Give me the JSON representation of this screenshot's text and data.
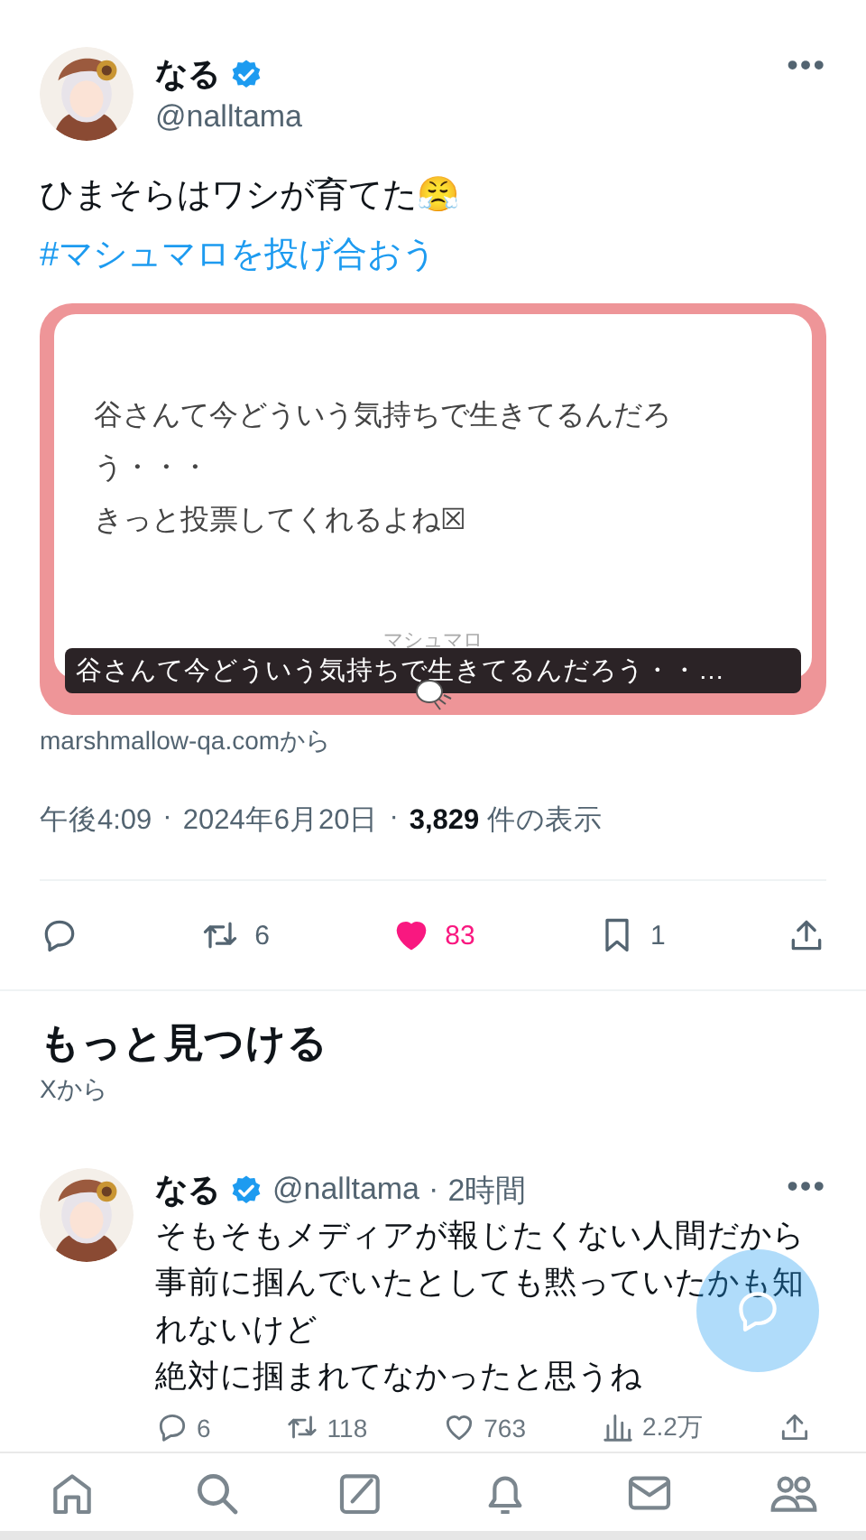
{
  "tweet": {
    "author": {
      "name": "なる",
      "verified": true,
      "handle": "@nalltama"
    },
    "more_label": "•••",
    "text": "ひまそらはワシが育てた😤",
    "hashtag": "#マシュマロを投げ合おう",
    "card": {
      "lines": [
        "谷さんて今どういう気持ちで生きてるんだろ",
        "う・・・",
        "きっと投票してくれるよね☒"
      ],
      "brand": "マシュマロ",
      "caption": "谷さんて今どういう気持ちで生きてるんだろう・・…",
      "source": "marshmallow-qa.comから"
    },
    "meta": {
      "separator": "·",
      "time": "午後4:09",
      "date": "2024年6月20日",
      "views": "3,829",
      "views_label": "件の表示"
    },
    "actions": [
      {
        "kind": "reply"
      },
      {
        "kind": "retweet",
        "count": "6"
      },
      {
        "kind": "like",
        "count": "83",
        "active": true
      },
      {
        "kind": "bookmark",
        "count": "1",
        "active": false
      },
      {
        "kind": "share"
      }
    ]
  },
  "more": {
    "title": "もっと見つける",
    "subtitle": "Xから"
  },
  "related": {
    "author": {
      "name": "なる",
      "verified": true,
      "handle": "@nalltama"
    },
    "separator": "·",
    "time": "2時間",
    "more_label": "•••",
    "lines": [
      "そもそもメディアが報じたくない人間だから",
      "事前に掴んでいたとしても黙っていたかも知",
      "れないけど",
      "絶対に掴まれてなかったと思うね"
    ],
    "actions": [
      {
        "kind": "reply",
        "count": "6"
      },
      {
        "kind": "retweet",
        "count": "118"
      },
      {
        "kind": "like",
        "count": "763",
        "active": false
      },
      {
        "kind": "views",
        "count": "2.2万"
      },
      {
        "kind": "share"
      }
    ]
  },
  "nav": [
    {
      "kind": "home",
      "selected": false
    },
    {
      "kind": "search",
      "selected": false
    },
    {
      "kind": "compose",
      "selected": false
    },
    {
      "kind": "notifications",
      "selected": false
    },
    {
      "kind": "messages",
      "selected": false
    },
    {
      "kind": "communities",
      "selected": false
    }
  ]
}
